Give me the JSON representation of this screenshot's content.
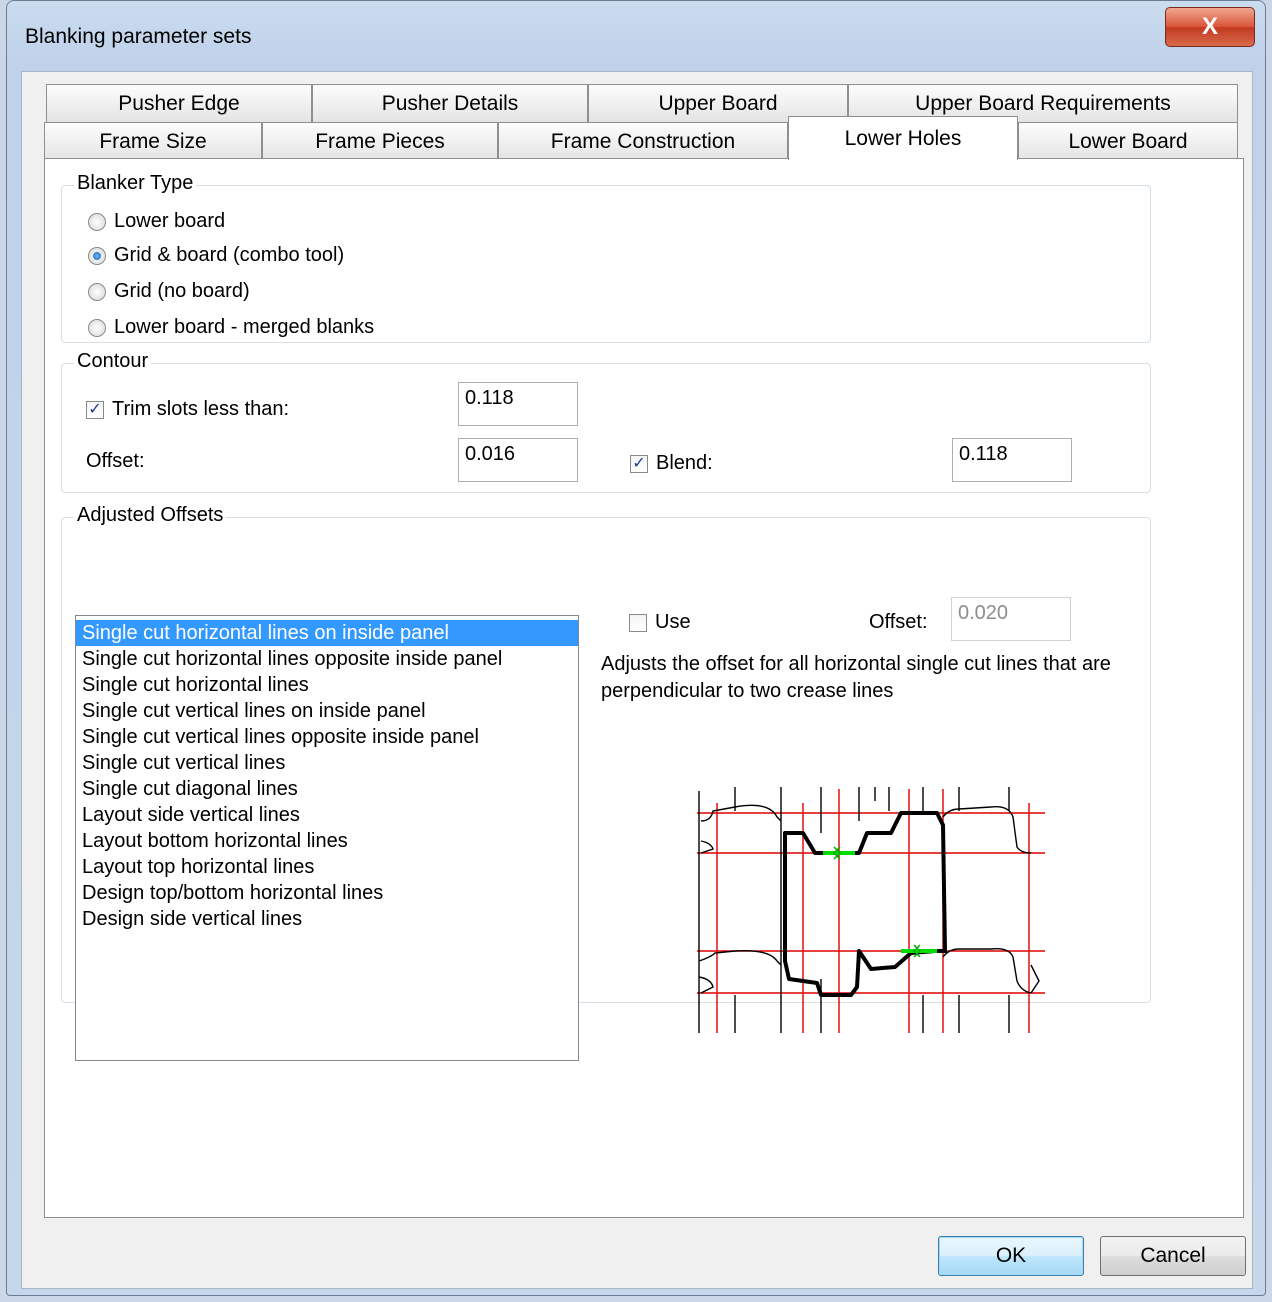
{
  "window": {
    "title": "Blanking parameter sets",
    "close_glyph": "X"
  },
  "tabs": {
    "back_row": [
      {
        "label": "Pusher Edge"
      },
      {
        "label": "Pusher Details"
      },
      {
        "label": "Upper Board"
      },
      {
        "label": "Upper Board Requirements"
      }
    ],
    "front_row": [
      {
        "label": "Frame Size"
      },
      {
        "label": "Frame Pieces"
      },
      {
        "label": "Frame Construction"
      },
      {
        "label": "Lower Holes"
      },
      {
        "label": "Lower Board"
      }
    ],
    "active": "Lower Holes"
  },
  "blanker_type": {
    "title": "Blanker Type",
    "options": [
      {
        "label": "Lower board",
        "selected": false
      },
      {
        "label": "Grid & board (combo tool)",
        "selected": true
      },
      {
        "label": "Grid (no board)",
        "selected": false
      },
      {
        "label": "Lower board - merged blanks",
        "selected": false
      }
    ]
  },
  "contour": {
    "title": "Contour",
    "trim_label": "Trim slots less than:",
    "trim_checked": true,
    "trim_value": "0.118",
    "offset_label": "Offset:",
    "offset_value": "0.016",
    "blend_label": "Blend:",
    "blend_checked": true,
    "blend_value": "0.118"
  },
  "adjusted_offsets": {
    "title": "Adjusted Offsets",
    "items": [
      "Single cut horizontal lines on inside panel",
      "Single cut horizontal lines opposite inside panel",
      "Single cut horizontal lines",
      "Single cut vertical lines on inside panel",
      "Single cut vertical lines opposite inside panel",
      "Single cut vertical lines",
      "Single cut diagonal lines",
      "Layout side vertical lines",
      "Layout bottom horizontal lines",
      "Layout top horizontal lines",
      "Design top/bottom horizontal lines",
      "Design side vertical lines"
    ],
    "selected_index": 0,
    "use_label": "Use",
    "use_checked": false,
    "offset_label": "Offset:",
    "offset_value": "0.020",
    "description": "Adjusts the offset for all horizontal single cut lines that are perpendicular to two crease lines"
  },
  "buttons": {
    "ok": "OK",
    "cancel": "Cancel"
  },
  "colors": {
    "selection": "#3399ff",
    "grid_red": "#e00000",
    "highlight_green": "#00dd00"
  }
}
